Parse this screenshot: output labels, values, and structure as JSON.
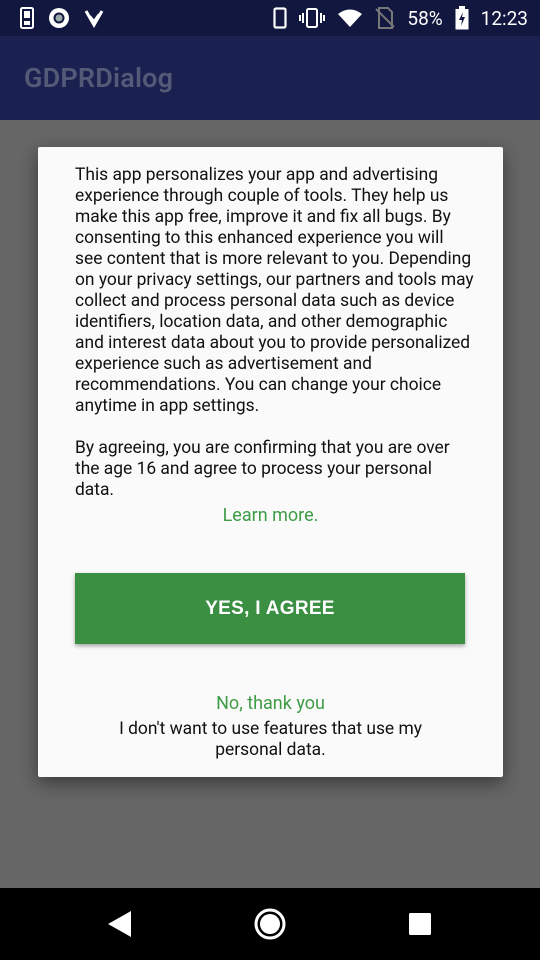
{
  "status_bar": {
    "battery_percent": "58%",
    "time": "12:23",
    "icons_left": [
      "sim-card-icon",
      "circle-app-icon",
      "download-check-icon"
    ],
    "icons_right": [
      "phone-icon",
      "vibrate-icon",
      "wifi-icon",
      "no-sim-icon",
      "battery-charging-icon"
    ]
  },
  "app_bar": {
    "title": "GDPRDialog"
  },
  "dialog": {
    "paragraph_1": "This app personalizes your app and advertising experience through couple of tools. They help us make this app free, improve it and fix all bugs. By consenting to this enhanced experience you will see content that is more relevant to you. Depending on your privacy settings, our partners and tools may collect and process personal data such as device identifiers, location data, and other demographic and interest data about you to provide personalized experience such as advertisement and recommendations. You can change your choice anytime in app settings.",
    "paragraph_2": "By agreeing, you are confirming that you are over the age 16 and agree to process your personal data.",
    "learn_more": "Learn more.",
    "agree_button": "YES, I AGREE",
    "decline_link": "No, thank you",
    "decline_sub": "I don't want to use features that use my personal data."
  },
  "nav_bar": {
    "icons": [
      "back-icon",
      "home-icon",
      "recents-icon"
    ]
  },
  "colors": {
    "accent_green": "#3a8f43",
    "link_green": "#3e9c46",
    "status_bar": "#12173f",
    "app_bar": "#1a2150"
  }
}
